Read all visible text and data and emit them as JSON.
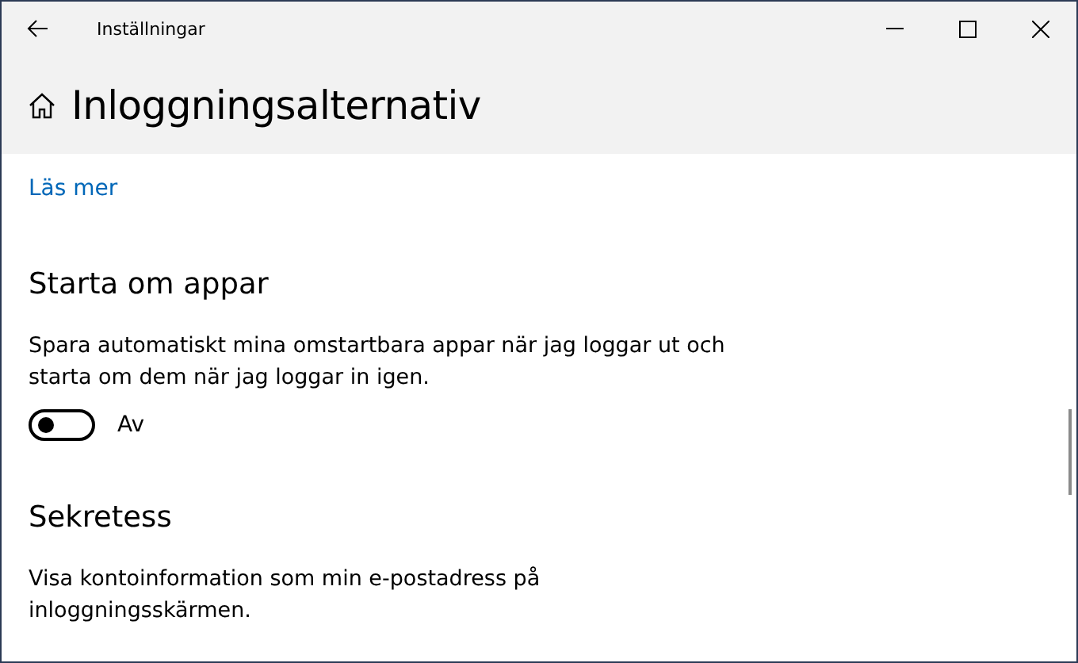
{
  "window": {
    "title": "Inställningar"
  },
  "page": {
    "title": "Inloggningsalternativ"
  },
  "sections": [
    {
      "kind": "link",
      "text": "Läs mer"
    },
    {
      "kind": "heading",
      "text": "Starta om appar"
    },
    {
      "kind": "paragraph",
      "text": "Spara automatiskt mina omstartbara appar när jag loggar ut och starta om dem när jag loggar in igen."
    },
    {
      "kind": "toggle",
      "on": false,
      "label": "Av"
    },
    {
      "kind": "heading",
      "text": "Sekretess"
    },
    {
      "kind": "paragraph",
      "text": "Visa kontoinformation som min e-postadress på inloggningsskärmen."
    }
  ]
}
